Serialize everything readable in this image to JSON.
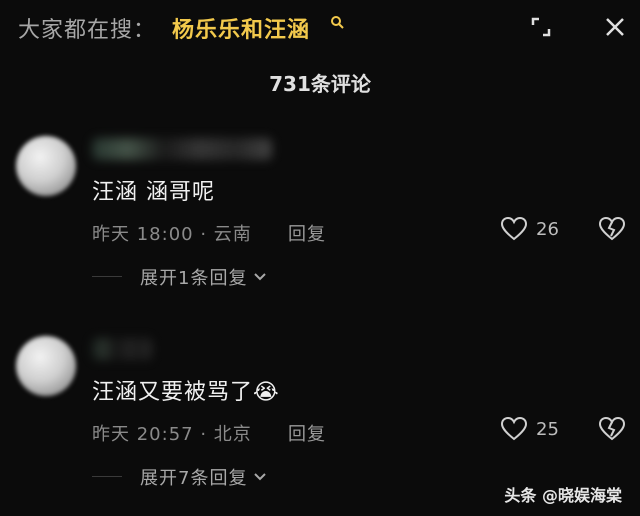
{
  "header": {
    "search_prefix": "大家都在搜：",
    "search_keyword": "杨乐乐和汪涵",
    "search_mini_icon": "search-icon"
  },
  "comments_title": "731条评论",
  "comments": [
    {
      "text": "汪涵 涵哥呢",
      "meta": "昨天 18:00 · 云南",
      "reply_label": "回复",
      "likes": "26",
      "expand_label": "展开1条回复"
    },
    {
      "text": "汪涵又要被骂了😭",
      "meta": "昨天 20:57 · 北京",
      "reply_label": "回复",
      "likes": "25",
      "expand_label": "展开7条回复"
    }
  ],
  "watermark": "头条 @晓娱海棠",
  "colors": {
    "background": "#0b0b0b",
    "keyword": "#f2c94c",
    "text": "#f0f0f0",
    "meta": "#8a8a8a"
  }
}
